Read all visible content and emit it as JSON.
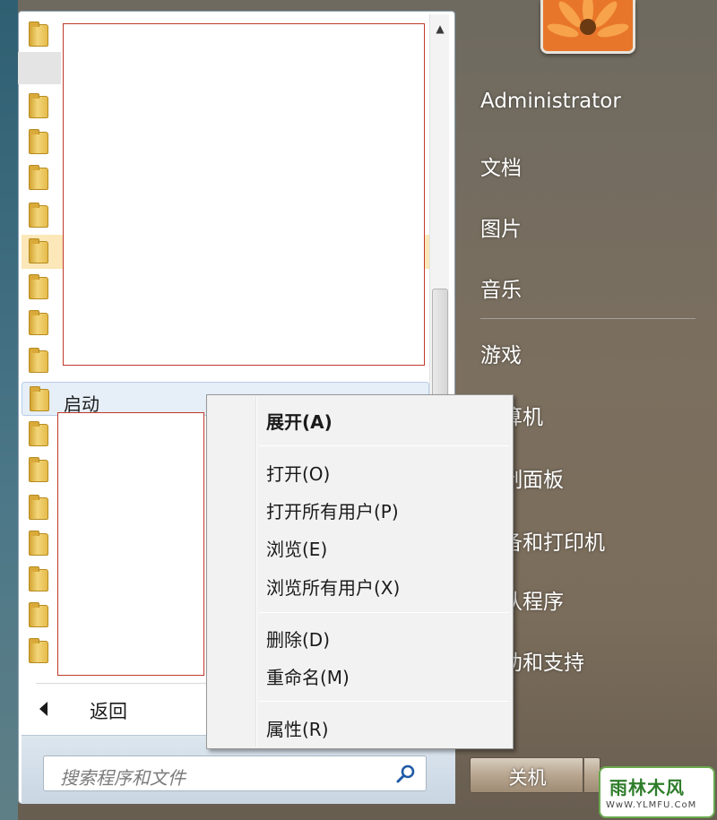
{
  "left_panel": {
    "highlighted_folder": "启动",
    "back_label": "返回",
    "search_placeholder": "搜索程序和文件"
  },
  "right_panel": {
    "user_name": "Administrator",
    "items": [
      "文档",
      "图片",
      "音乐",
      "游戏",
      "算机",
      "制面板",
      "备和打印机",
      "认程序",
      "助和支持"
    ]
  },
  "shutdown_label": "关机",
  "context_menu": {
    "items": [
      {
        "label": "展开(A)",
        "bold": true
      },
      {
        "label": "打开(O)"
      },
      {
        "label": "打开所有用户(P)"
      },
      {
        "label": "浏览(E)"
      },
      {
        "label": "浏览所有用户(X)"
      },
      {
        "label": "删除(D)"
      },
      {
        "label": "重命名(M)"
      },
      {
        "label": "属性(R)"
      }
    ]
  },
  "watermark": {
    "title": "雨林木风",
    "url": "WwW.YLMFU.CoM"
  },
  "colors": {
    "menu_background": "#f2f2f2",
    "highlight": "#e6eef8",
    "redaction_border": "#c0392b"
  },
  "icons": [
    "folder-icon",
    "search-icon",
    "back-arrow-icon",
    "scroll-up-icon",
    "flower-avatar"
  ]
}
